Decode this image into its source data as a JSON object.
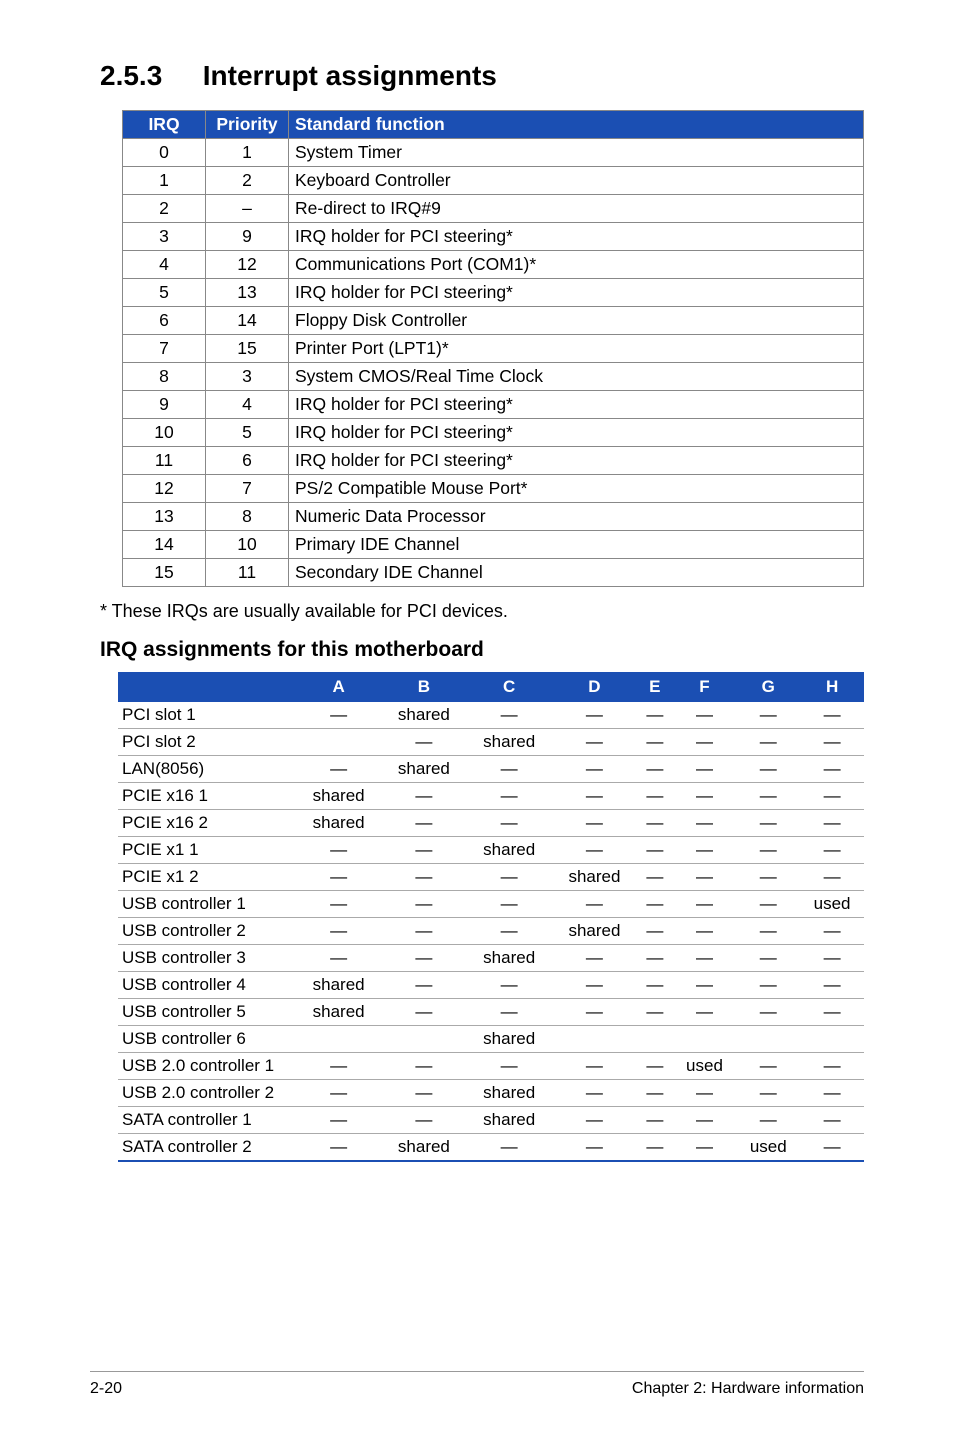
{
  "section": {
    "number": "2.5.3",
    "title": "Interrupt assignments"
  },
  "irq_table": {
    "headers": [
      "IRQ",
      "Priority",
      "Standard function"
    ],
    "rows": [
      [
        "0",
        "1",
        "System Timer"
      ],
      [
        "1",
        "2",
        "Keyboard Controller"
      ],
      [
        "2",
        "–",
        "Re-direct to IRQ#9"
      ],
      [
        "3",
        "9",
        "IRQ holder for PCI steering*"
      ],
      [
        "4",
        "12",
        "Communications Port (COM1)*"
      ],
      [
        "5",
        "13",
        "IRQ holder for PCI steering*"
      ],
      [
        "6",
        "14",
        "Floppy Disk Controller"
      ],
      [
        "7",
        "15",
        "Printer Port (LPT1)*"
      ],
      [
        "8",
        "3",
        "System CMOS/Real Time Clock"
      ],
      [
        "9",
        "4",
        "IRQ holder for PCI steering*"
      ],
      [
        "10",
        "5",
        "IRQ holder for PCI steering*"
      ],
      [
        "11",
        "6",
        "IRQ holder for PCI steering*"
      ],
      [
        "12",
        "7",
        "PS/2 Compatible Mouse Port*"
      ],
      [
        "13",
        "8",
        "Numeric Data Processor"
      ],
      [
        "14",
        "10",
        "Primary IDE Channel"
      ],
      [
        "15",
        "11",
        "Secondary IDE Channel"
      ]
    ]
  },
  "note": "* These IRQs are usually available for PCI devices.",
  "assign_title": "IRQ assignments for this motherboard",
  "assign_table": {
    "headers": [
      "",
      "A",
      "B",
      "C",
      "D",
      "E",
      "F",
      "G",
      "H"
    ],
    "rows": [
      [
        "PCI slot 1",
        "—",
        "shared",
        "—",
        "—",
        "—",
        "—",
        "—",
        "—"
      ],
      [
        "PCI slot 2",
        "",
        "—",
        "shared",
        "—",
        "—",
        "—",
        "—",
        "—"
      ],
      [
        "LAN(8056)",
        "—",
        "shared",
        "—",
        "—",
        "—",
        "—",
        "—",
        "—"
      ],
      [
        "PCIE x16 1",
        "shared",
        "—",
        "—",
        "—",
        "—",
        "—",
        "—",
        "—"
      ],
      [
        "PCIE x16 2",
        "shared",
        "—",
        "—",
        "—",
        "—",
        "—",
        "—",
        "—"
      ],
      [
        "PCIE x1 1",
        "—",
        "—",
        "shared",
        "—",
        "—",
        "—",
        "—",
        "—"
      ],
      [
        "PCIE x1 2",
        "—",
        "—",
        "—",
        "shared",
        "—",
        "—",
        "—",
        "—"
      ],
      [
        "USB controller 1",
        "—",
        "—",
        "—",
        "—",
        "—",
        "—",
        "—",
        "used"
      ],
      [
        "USB controller 2",
        "—",
        "—",
        "—",
        "shared",
        "—",
        "—",
        "—",
        "—"
      ],
      [
        "USB controller 3",
        "—",
        "—",
        "shared",
        "—",
        "—",
        "—",
        "—",
        "—"
      ],
      [
        "USB controller 4",
        "shared",
        "—",
        "—",
        "—",
        "—",
        "—",
        "—",
        "—"
      ],
      [
        "USB controller 5",
        "shared",
        "—",
        "—",
        "—",
        "—",
        "—",
        "—",
        "—"
      ],
      [
        "USB controller 6",
        "",
        "",
        "shared",
        "",
        "",
        "",
        "",
        ""
      ],
      [
        "USB 2.0 controller 1",
        "—",
        "—",
        "—",
        "—",
        "—",
        "used",
        "—",
        "—"
      ],
      [
        "USB 2.0 controller 2",
        "—",
        "—",
        "shared",
        "—",
        "—",
        "—",
        "—",
        "—"
      ],
      [
        "SATA controller 1",
        "—",
        "—",
        "shared",
        "—",
        "—",
        "—",
        "—",
        "—"
      ],
      [
        "SATA controller 2",
        "—",
        "shared",
        "—",
        "—",
        "—",
        "—",
        "used",
        "—"
      ]
    ]
  },
  "footer": {
    "left": "2-20",
    "right": "Chapter 2: Hardware information"
  }
}
